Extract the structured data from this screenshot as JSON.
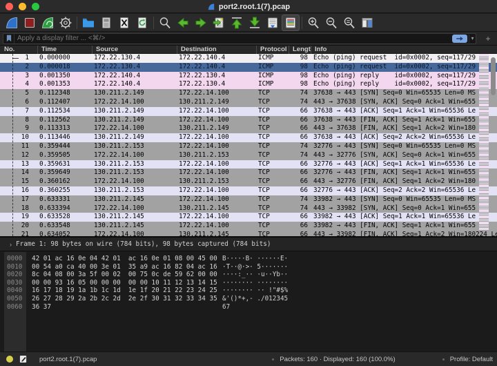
{
  "titlebar": {
    "title": "port2.root.1(7).pcap"
  },
  "toolbar": {
    "icons": [
      "start-capture-fin",
      "stop-capture",
      "restart-capture-fin",
      "capture-options-gear",
      "open-file-folder",
      "save-file",
      "close-file",
      "reload-file",
      "find-packet-magnifier",
      "go-back-arrow",
      "go-forward-arrow",
      "go-to-packet",
      "go-first-packet",
      "go-last-packet",
      "auto-scroll",
      "colorize-packets",
      "zoom-in-magnifier",
      "zoom-out-magnifier",
      "zoom-normal-magnifier",
      "resize-columns"
    ]
  },
  "filter_bar": {
    "placeholder": "Apply a display filter ... <⌘/>",
    "apply_caret": "▾",
    "add_button": "+"
  },
  "packet_list": {
    "columns": [
      "No.",
      "Time",
      "Source",
      "Destination",
      "Protocol",
      "Length",
      "Info"
    ],
    "rows": [
      {
        "no": "1",
        "time": "0.000000",
        "src": "172.22.130.4",
        "dst": "172.22.140.4",
        "proto": "ICMP",
        "len": "98",
        "info": "Echo (ping) request  id=0x0002, seq=117/29",
        "color": "white"
      },
      {
        "no": "2",
        "time": "0.000018",
        "src": "172.22.130.4",
        "dst": "172.22.140.4",
        "proto": "ICMP",
        "len": "98",
        "info": "Echo (ping) request  id=0x0002, seq=117/29",
        "color": "sel"
      },
      {
        "no": "3",
        "time": "0.001350",
        "src": "172.22.140.4",
        "dst": "172.22.130.4",
        "proto": "ICMP",
        "len": "98",
        "info": "Echo (ping) reply    id=0x0002, seq=117/29",
        "color": "icmp"
      },
      {
        "no": "4",
        "time": "0.001353",
        "src": "172.22.140.4",
        "dst": "172.22.130.4",
        "proto": "ICMP",
        "len": "98",
        "info": "Echo (ping) reply    id=0x0002, seq=117/29",
        "color": "icmp"
      },
      {
        "no": "5",
        "time": "0.112348",
        "src": "130.211.2.149",
        "dst": "172.22.14.100",
        "proto": "TCP",
        "len": "74",
        "info": "37638 → 443 [SYN] Seq=0 Win=65535 Len=0 MS",
        "color": "gray"
      },
      {
        "no": "6",
        "time": "0.112407",
        "src": "172.22.14.100",
        "dst": "130.211.2.149",
        "proto": "TCP",
        "len": "74",
        "info": "443 → 37638 [SYN, ACK] Seq=0 Ack=1 Win=655",
        "color": "gray"
      },
      {
        "no": "7",
        "time": "0.112534",
        "src": "130.211.2.149",
        "dst": "172.22.14.100",
        "proto": "TCP",
        "len": "66",
        "info": "37638 → 443 [ACK] Seq=1 Ack=1 Win=65536 Le",
        "color": "lav"
      },
      {
        "no": "8",
        "time": "0.112562",
        "src": "130.211.2.149",
        "dst": "172.22.14.100",
        "proto": "TCP",
        "len": "66",
        "info": "37638 → 443 [FIN, ACK] Seq=1 Ack=1 Win=655",
        "color": "gray"
      },
      {
        "no": "9",
        "time": "0.113313",
        "src": "172.22.14.100",
        "dst": "130.211.2.149",
        "proto": "TCP",
        "len": "66",
        "info": "443 → 37638 [FIN, ACK] Seq=1 Ack=2 Win=180",
        "color": "gray"
      },
      {
        "no": "10",
        "time": "0.113446",
        "src": "130.211.2.149",
        "dst": "172.22.14.100",
        "proto": "TCP",
        "len": "66",
        "info": "37638 → 443 [ACK] Seq=2 Ack=2 Win=65536 Le",
        "color": "lav"
      },
      {
        "no": "11",
        "time": "0.359444",
        "src": "130.211.2.153",
        "dst": "172.22.14.100",
        "proto": "TCP",
        "len": "74",
        "info": "32776 → 443 [SYN] Seq=0 Win=65535 Len=0 MS",
        "color": "gray"
      },
      {
        "no": "12",
        "time": "0.359505",
        "src": "172.22.14.100",
        "dst": "130.211.2.153",
        "proto": "TCP",
        "len": "74",
        "info": "443 → 32776 [SYN, ACK] Seq=0 Ack=1 Win=655",
        "color": "gray"
      },
      {
        "no": "13",
        "time": "0.359631",
        "src": "130.211.2.153",
        "dst": "172.22.14.100",
        "proto": "TCP",
        "len": "66",
        "info": "32776 → 443 [ACK] Seq=1 Ack=1 Win=65536 Le",
        "color": "lav"
      },
      {
        "no": "14",
        "time": "0.359649",
        "src": "130.211.2.153",
        "dst": "172.22.14.100",
        "proto": "TCP",
        "len": "66",
        "info": "32776 → 443 [FIN, ACK] Seq=1 Ack=1 Win=655",
        "color": "gray"
      },
      {
        "no": "15",
        "time": "0.360162",
        "src": "172.22.14.100",
        "dst": "130.211.2.153",
        "proto": "TCP",
        "len": "66",
        "info": "443 → 32776 [FIN, ACK] Seq=1 Ack=2 Win=180",
        "color": "gray"
      },
      {
        "no": "16",
        "time": "0.360255",
        "src": "130.211.2.153",
        "dst": "172.22.14.100",
        "proto": "TCP",
        "len": "66",
        "info": "32776 → 443 [ACK] Seq=2 Ack=2 Win=65536 Le",
        "color": "lav"
      },
      {
        "no": "17",
        "time": "0.633331",
        "src": "130.211.2.145",
        "dst": "172.22.14.100",
        "proto": "TCP",
        "len": "74",
        "info": "33982 → 443 [SYN] Seq=0 Win=65535 Len=0 MS",
        "color": "gray"
      },
      {
        "no": "18",
        "time": "0.633394",
        "src": "172.22.14.100",
        "dst": "130.211.2.145",
        "proto": "TCP",
        "len": "74",
        "info": "443 → 33982 [SYN, ACK] Seq=0 Ack=1 Win=655",
        "color": "gray"
      },
      {
        "no": "19",
        "time": "0.633528",
        "src": "130.211.2.145",
        "dst": "172.22.14.100",
        "proto": "TCP",
        "len": "66",
        "info": "33982 → 443 [ACK] Seq=1 Ack=1 Win=65536 Le",
        "color": "lav"
      },
      {
        "no": "20",
        "time": "0.633548",
        "src": "130.211.2.145",
        "dst": "172.22.14.100",
        "proto": "TCP",
        "len": "66",
        "info": "33982 → 443 [FIN, ACK] Seq=1 Ack=1 Win=655",
        "color": "gray"
      },
      {
        "no": "21",
        "time": "0.634052",
        "src": "172.22.14.100",
        "dst": "130.211.2.145",
        "proto": "TCP",
        "len": "66",
        "info": "443 → 33982 [FIN, ACK] Seq=1 Ack=2 Win=180224 Le",
        "color": "gray"
      }
    ]
  },
  "details_pane": {
    "expander": "›",
    "line": "Frame 1: 98 bytes on wire (784 bits), 98 bytes captured (784 bits)"
  },
  "hex_pane": {
    "lines": [
      {
        "offset": "0000",
        "hex": "42 01 ac 16 0e 04 42 01  ac 16 0e 01 08 00 45 00",
        "ascii": "B·····B· ······E·"
      },
      {
        "offset": "0010",
        "hex": "00 54 a0 ca 40 00 3e 01  35 a9 ac 16 82 04 ac 16",
        "ascii": "·T··@·>· 5·······"
      },
      {
        "offset": "0020",
        "hex": "8c 04 08 00 3a 5f 00 02  00 75 0c de 59 62 00 00",
        "ascii": "····:_·· ·u··Yb··"
      },
      {
        "offset": "0030",
        "hex": "00 00 93 16 05 00 00 00  00 00 10 11 12 13 14 15",
        "ascii": "········ ········"
      },
      {
        "offset": "0040",
        "hex": "16 17 18 19 1a 1b 1c 1d  1e 1f 20 21 22 23 24 25",
        "ascii": "········ ·· !\"#$%"
      },
      {
        "offset": "0050",
        "hex": "26 27 28 29 2a 2b 2c 2d  2e 2f 30 31 32 33 34 35",
        "ascii": "&'()*+,- ./012345"
      },
      {
        "offset": "0060",
        "hex": "36 37",
        "ascii": "67"
      }
    ]
  },
  "status_bar": {
    "filename": "port2.root.1(7).pcap",
    "packets_info": "Packets: 160 · Displayed: 160 (100.0%)",
    "profile": "Profile: Default"
  },
  "colors": {
    "selection_bg": "#47689b",
    "icmp_row": "#f3d7ee",
    "tcp_synfin_row": "#a2a2a2",
    "tcp_ack_row": "#e3e2f5",
    "accent_blue": "#7ea6e0",
    "expert_indicator": "#d6cf4b"
  }
}
